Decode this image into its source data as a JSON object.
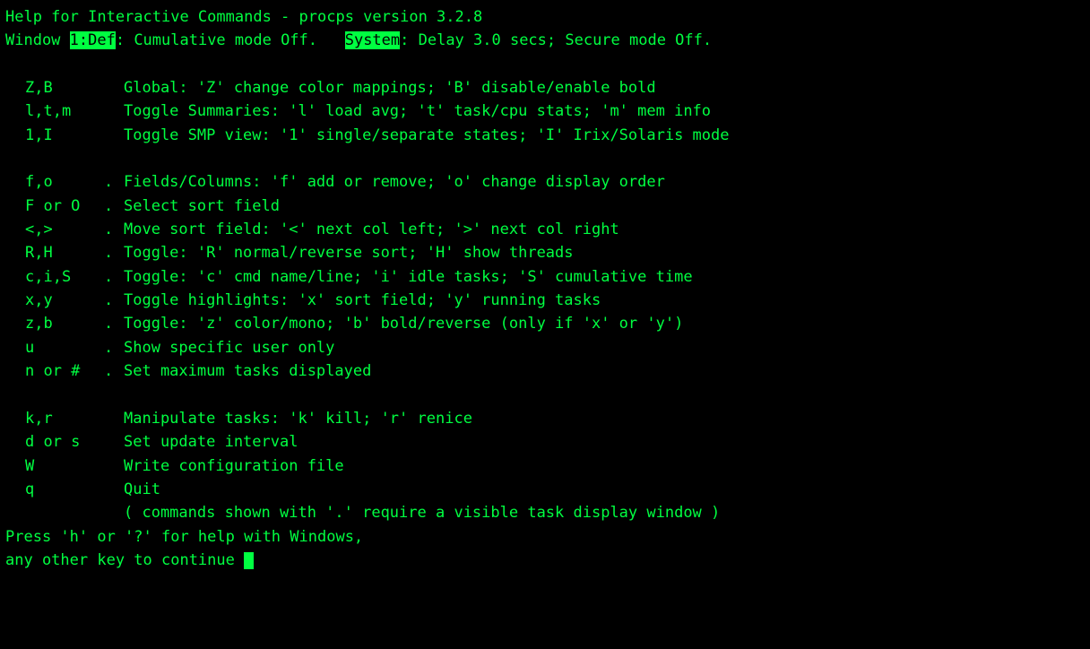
{
  "header": {
    "title": "Help for Interactive Commands - procps version 3.2.8",
    "window_prefix": "Window ",
    "window_label": "1:Def",
    "window_suffix": ": Cumulative mode Off.   ",
    "system_label": "System",
    "system_suffix": ": Delay 3.0 secs; Secure mode Off."
  },
  "groups": [
    {
      "items": [
        {
          "keys": "Z,B",
          "mark": " ",
          "desc": "Global: 'Z' change color mappings; 'B' disable/enable bold"
        },
        {
          "keys": "l,t,m",
          "mark": " ",
          "desc": "Toggle Summaries: 'l' load avg; 't' task/cpu stats; 'm' mem info"
        },
        {
          "keys": "1,I",
          "mark": " ",
          "desc": "Toggle SMP view: '1' single/separate states; 'I' Irix/Solaris mode"
        }
      ]
    },
    {
      "items": [
        {
          "keys": "f,o",
          "mark": ".",
          "desc": "Fields/Columns: 'f' add or remove; 'o' change display order"
        },
        {
          "keys": "F or O",
          "mark": ".",
          "desc": "Select sort field"
        },
        {
          "keys": "<,>",
          "mark": ".",
          "desc": "Move sort field: '<' next col left; '>' next col right"
        },
        {
          "keys": "R,H",
          "mark": ".",
          "desc": "Toggle: 'R' normal/reverse sort; 'H' show threads"
        },
        {
          "keys": "c,i,S",
          "mark": ".",
          "desc": "Toggle: 'c' cmd name/line; 'i' idle tasks; 'S' cumulative time"
        },
        {
          "keys": "x,y",
          "mark": ".",
          "desc": "Toggle highlights: 'x' sort field; 'y' running tasks"
        },
        {
          "keys": "z,b",
          "mark": ".",
          "desc": "Toggle: 'z' color/mono; 'b' bold/reverse (only if 'x' or 'y')"
        },
        {
          "keys": "u",
          "mark": ".",
          "desc": "Show specific user only"
        },
        {
          "keys": "n or #",
          "mark": ".",
          "desc": "Set maximum tasks displayed"
        }
      ]
    },
    {
      "items": [
        {
          "keys": "k,r",
          "mark": " ",
          "desc": "Manipulate tasks: 'k' kill; 'r' renice"
        },
        {
          "keys": "d or s",
          "mark": " ",
          "desc": "Set update interval"
        },
        {
          "keys": "W",
          "mark": " ",
          "desc": "Write configuration file"
        },
        {
          "keys": "q",
          "mark": " ",
          "desc": "Quit"
        }
      ]
    }
  ],
  "footnote": "( commands shown with '.' require a visible task display window )",
  "footer": {
    "line1": "Press 'h' or '?' for help with Windows,",
    "line2": "any other key to continue "
  }
}
